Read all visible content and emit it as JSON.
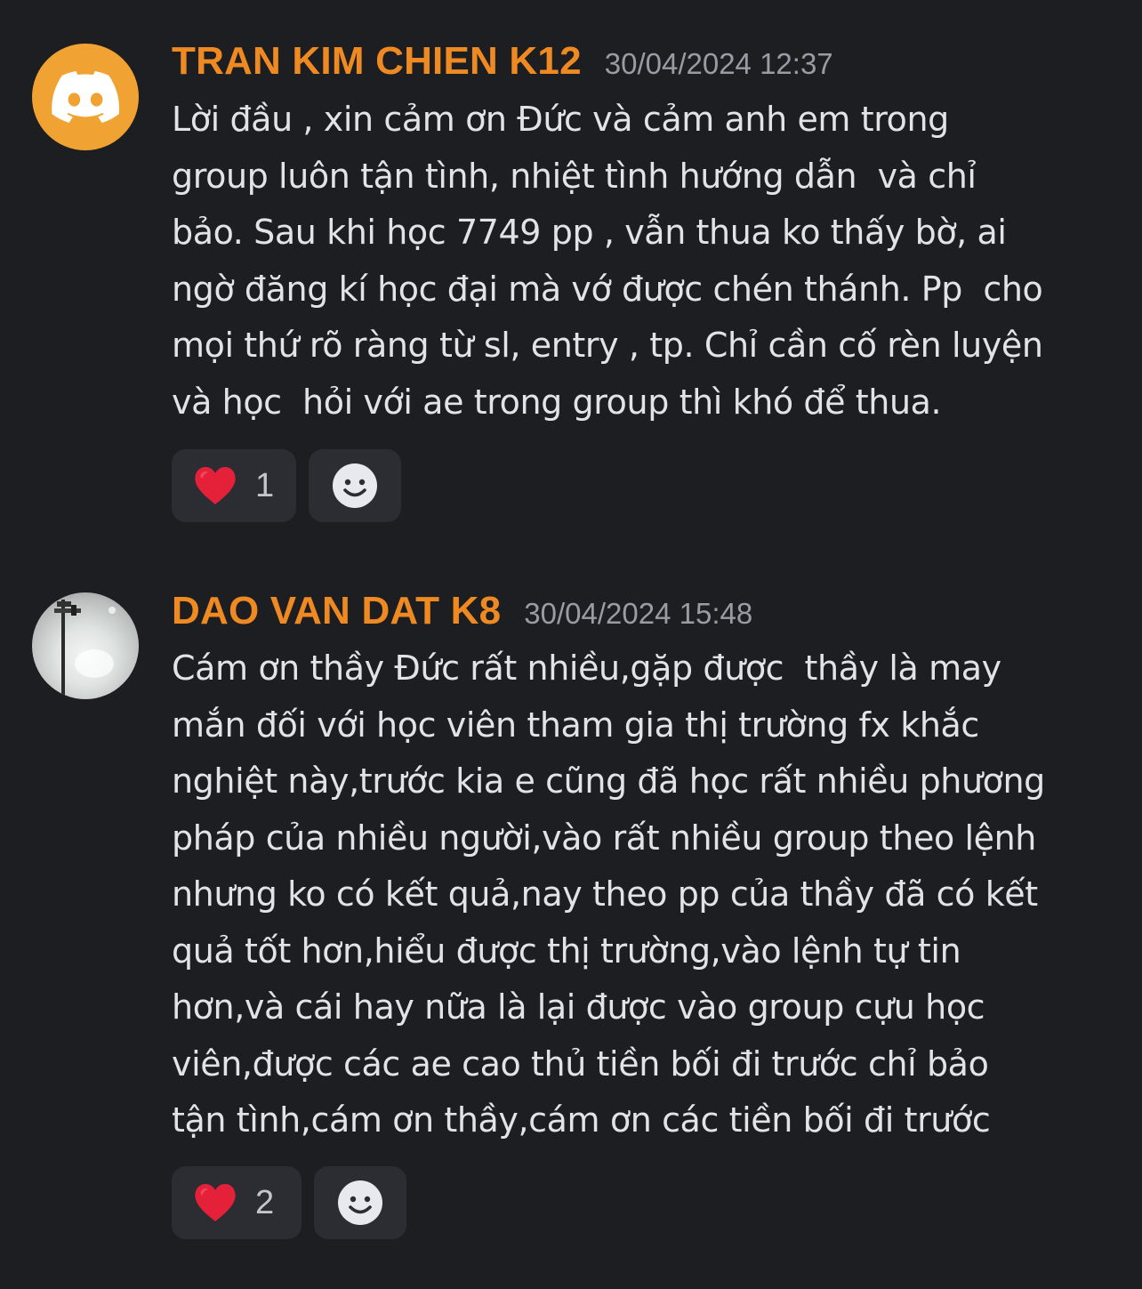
{
  "messages": [
    {
      "username": "TRAN KIM CHIEN K12",
      "timestamp": "30/04/2024 12:37",
      "avatar_icon": "discord-logo-icon",
      "avatar_color": "#f0a233",
      "lines": [
        "Lời đầu , xin cảm ơn Đức và cảm anh em trong",
        "group luôn tận tình, nhiệt tình hướng dẫn  và chỉ",
        "bảo. Sau khi học 7749 pp , vẫn thua ko thấy bờ, ai",
        "ngờ đăng kí học đại mà vớ được chén thánh. Pp  cho",
        "mọi thứ rõ ràng từ sl, entry , tp. Chỉ cần cố rèn luyện",
        "và học  hỏi với ae trong group thì khó để thua."
      ],
      "reactions": [
        {
          "icon": "heart-icon",
          "count": "1"
        }
      ],
      "add_reaction_icon": "smile-icon"
    },
    {
      "username": "DAO VAN DAT K8",
      "timestamp": "30/04/2024 15:48",
      "avatar_icon": "user-photo-avatar",
      "lines": [
        "Cám ơn thầy Đức rất nhiều,gặp được  thầy là may",
        "mắn đối với học viên tham gia thị trường fx khắc",
        "nghiệt này,trước kia e cũng đã học rất nhiều phương",
        "pháp của nhiều người,vào rất nhiều group theo lệnh",
        "nhưng ko có kết quả,nay theo pp của thầy đã có kết",
        "quả tốt hơn,hiểu được thị trường,vào lệnh tự tin",
        "hơn,và cái hay nữa là lại được vào group cựu học",
        "viên,được các ae cao thủ tiền bối đi trước chỉ bảo",
        "tận tình,cám ơn thầy,cám ơn các tiền bối đi trước"
      ],
      "reactions": [
        {
          "icon": "heart-icon",
          "count": "2"
        }
      ],
      "add_reaction_icon": "smile-icon"
    }
  ],
  "colors": {
    "background": "#1d1e22",
    "username": "#ef8a23",
    "timestamp": "#9a9ba4",
    "text": "#e2e3e8",
    "reaction_bg": "#2c2d33",
    "heart": "#e5213a"
  }
}
